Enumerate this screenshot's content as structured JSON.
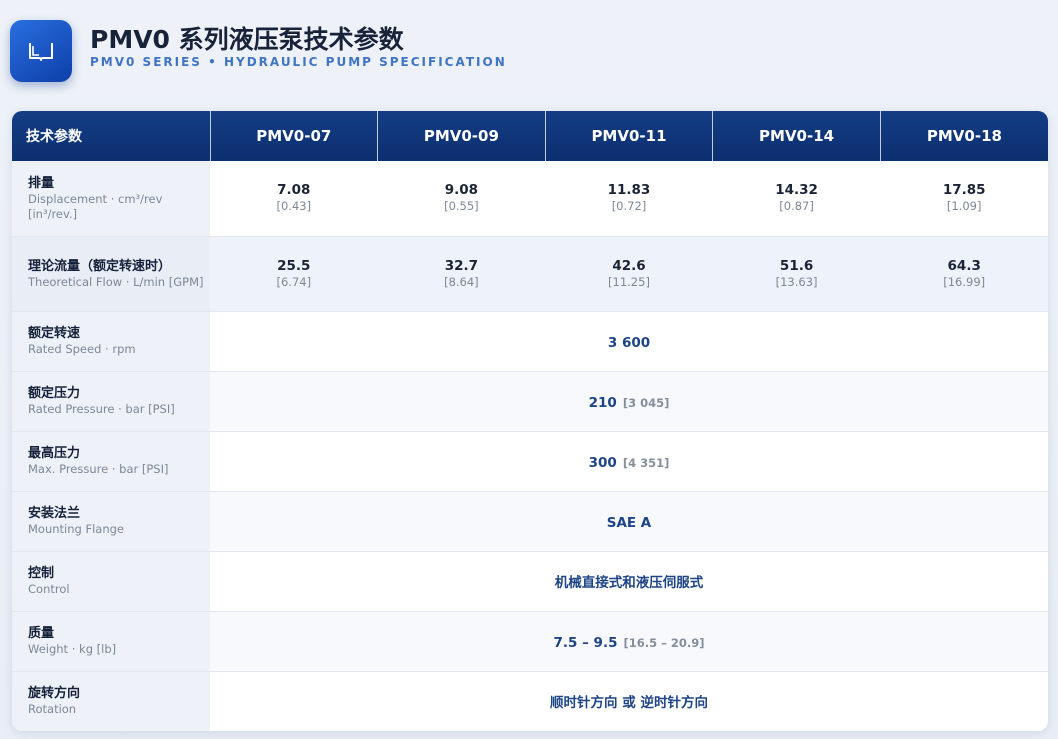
{
  "header": {
    "title": "PMV0 系列液压泵技术参数",
    "subtitle": "PMV0 SERIES • HYDRAULIC PUMP SPECIFICATION",
    "logo_icon": "book-icon"
  },
  "table": {
    "corner": "技术参数",
    "models": [
      "PMV0-07",
      "PMV0-09",
      "PMV0-11",
      "PMV0-14",
      "PMV0-18"
    ],
    "displacement": {
      "cn": "排量",
      "en": "Displacement · cm³/rev [in³/rev.]",
      "values": [
        {
          "main": "7.08",
          "sub": "[0.43]"
        },
        {
          "main": "9.08",
          "sub": "[0.55]"
        },
        {
          "main": "11.83",
          "sub": "[0.72]"
        },
        {
          "main": "14.32",
          "sub": "[0.87]"
        },
        {
          "main": "17.85",
          "sub": "[1.09]"
        }
      ]
    },
    "flow": {
      "cn": "理论流量（额定转速时）",
      "en": "Theoretical Flow · L/min [GPM]",
      "values": [
        {
          "main": "25.5",
          "sub": "[6.74]"
        },
        {
          "main": "32.7",
          "sub": "[8.64]"
        },
        {
          "main": "42.6",
          "sub": "[11.25]"
        },
        {
          "main": "51.6",
          "sub": "[13.63]"
        },
        {
          "main": "64.3",
          "sub": "[16.99]"
        }
      ]
    },
    "speed": {
      "cn": "额定转速",
      "en": "Rated Speed · rpm",
      "main": "3 600",
      "sub": ""
    },
    "rated_pressure": {
      "cn": "额定压力",
      "en": "Rated Pressure · bar [PSI]",
      "main": "210",
      "sub": "[3 045]"
    },
    "max_pressure": {
      "cn": "最高压力",
      "en": "Max. Pressure · bar [PSI]",
      "main": "300",
      "sub": "[4 351]"
    },
    "flange": {
      "cn": "安装法兰",
      "en": "Mounting Flange",
      "main": "SAE A",
      "sub": ""
    },
    "control": {
      "cn": "控制",
      "en": "Control",
      "main": "机械直接式和液压伺服式",
      "sub": ""
    },
    "weight": {
      "cn": "质量",
      "en": "Weight · kg [lb]",
      "main": "7.5 – 9.5",
      "sub": "[16.5 – 20.9]"
    },
    "rotation": {
      "cn": "旋转方向",
      "en": "Rotation",
      "main": "顺时针方向 或 逆时针方向",
      "sub": ""
    }
  },
  "colors": {
    "header_bg": "#0c2f6f",
    "accent": "#3f74c5",
    "value_blue": "#1d4487"
  }
}
